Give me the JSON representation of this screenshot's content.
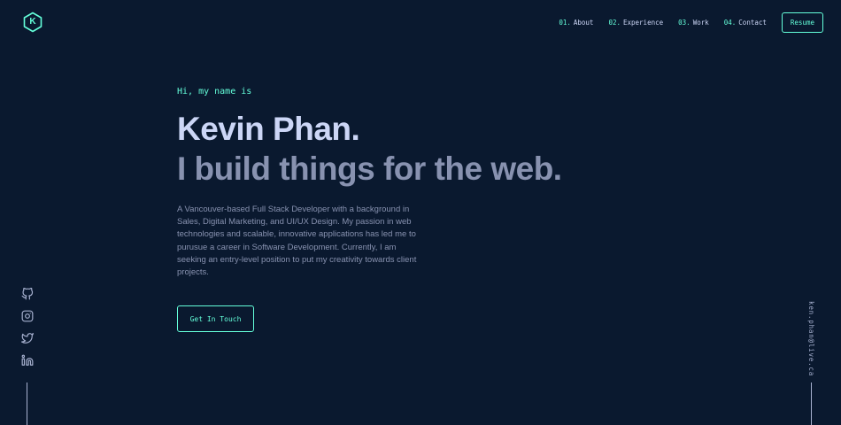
{
  "logo": {
    "letter": "K"
  },
  "nav": {
    "items": [
      {
        "num": "01.",
        "label": "About"
      },
      {
        "num": "02.",
        "label": "Experience"
      },
      {
        "num": "03.",
        "label": "Work"
      },
      {
        "num": "04.",
        "label": "Contact"
      }
    ],
    "resume_label": "Resume"
  },
  "hero": {
    "greeting": "Hi, my name is",
    "name": "Kevin Phan.",
    "tagline": "I build things for the web.",
    "intro": "A Vancouver-based Full Stack Developer with a background in Sales, Digital Marketing, and UI/UX Design. My passion in web technologies and scalable, innovative applications has led me to purusue a career in Software Development. Currently, I am seeking an entry-level position to put my creativity towards client projects.",
    "cta_label": "Get In Touch"
  },
  "social": {
    "icons": [
      "github-icon",
      "instagram-icon",
      "twitter-icon",
      "linkedin-icon"
    ]
  },
  "email": "ken.phan@live.ca",
  "colors": {
    "background": "#0a192f",
    "accent": "#64ffda",
    "heading": "#ccd6f6",
    "body": "#8892b0",
    "rail": "#a8b2d1"
  }
}
